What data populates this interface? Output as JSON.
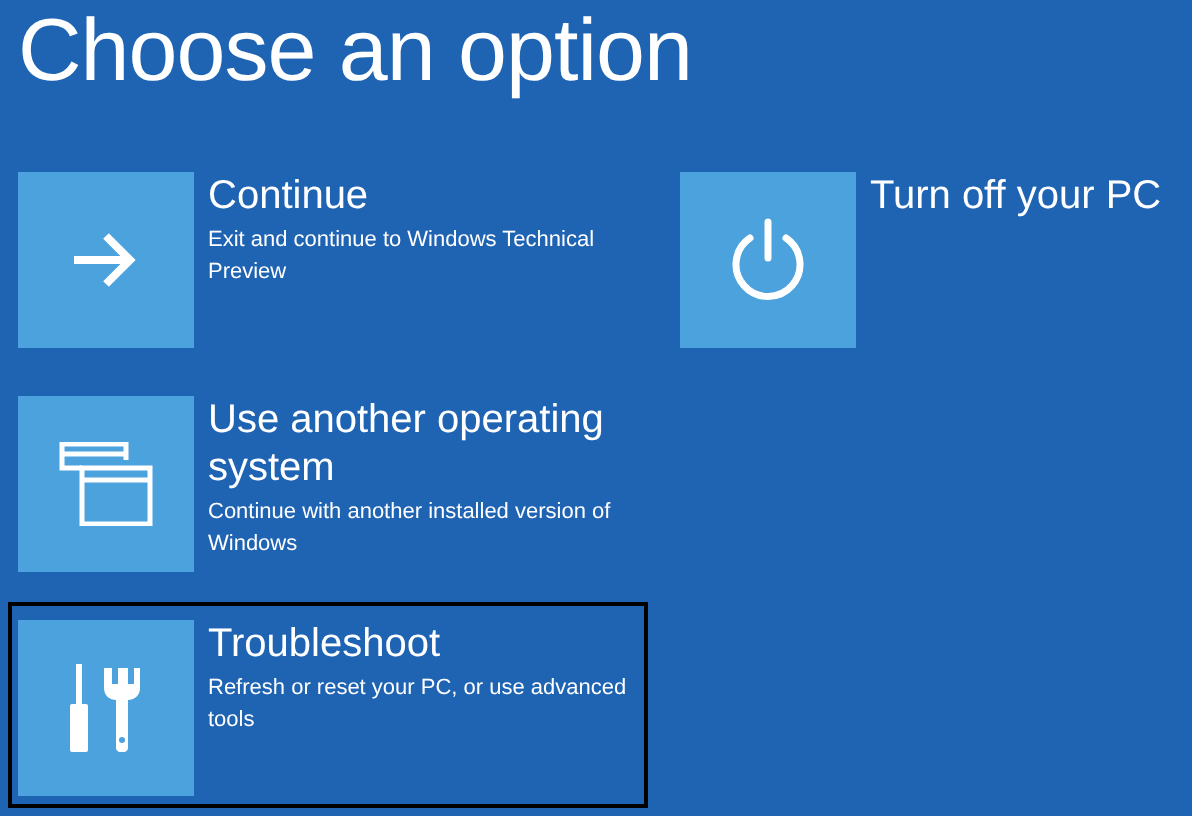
{
  "title": "Choose an option",
  "columns": [
    {
      "options": [
        {
          "kind": "arrow",
          "label": "Continue",
          "description": "Exit and continue to Windows Technical Preview",
          "selected": false
        },
        {
          "kind": "windows",
          "label": "Use another operating system",
          "description": "Continue with another installed version of Windows",
          "selected": false
        },
        {
          "kind": "tools",
          "label": "Troubleshoot",
          "description": "Refresh or reset your PC, or use advanced tools",
          "selected": true
        }
      ]
    },
    {
      "options": [
        {
          "kind": "power",
          "label": "Turn off your PC",
          "selected": false
        }
      ]
    }
  ]
}
